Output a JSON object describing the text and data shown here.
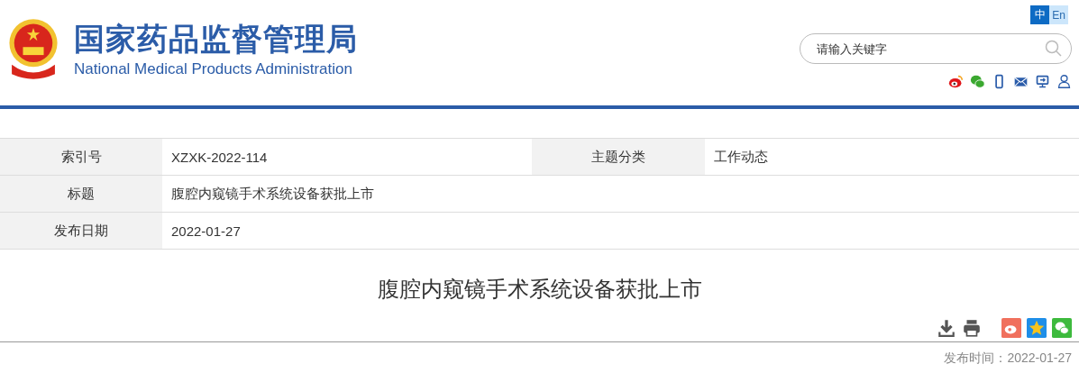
{
  "header": {
    "title_cn": "国家药品监督管理局",
    "title_en": "National Medical Products Administration",
    "languages": [
      {
        "label": "中",
        "selected": true
      },
      {
        "label": "En",
        "selected": false
      }
    ],
    "search": {
      "placeholder": "请输入关键字"
    }
  },
  "info_table": {
    "rows": [
      {
        "label": "索引号",
        "value": "XZXK-2022-114",
        "label_2": "主题分类",
        "value_2": "工作动态"
      },
      {
        "label": "标题",
        "value": "腹腔内窥镜手术系统设备获批上市"
      },
      {
        "label": "发布日期",
        "value": "2022-01-27"
      }
    ]
  },
  "article": {
    "title": "腹腔内窥镜手术系统设备获批上市",
    "published": "发布时间：2022-01-27"
  }
}
